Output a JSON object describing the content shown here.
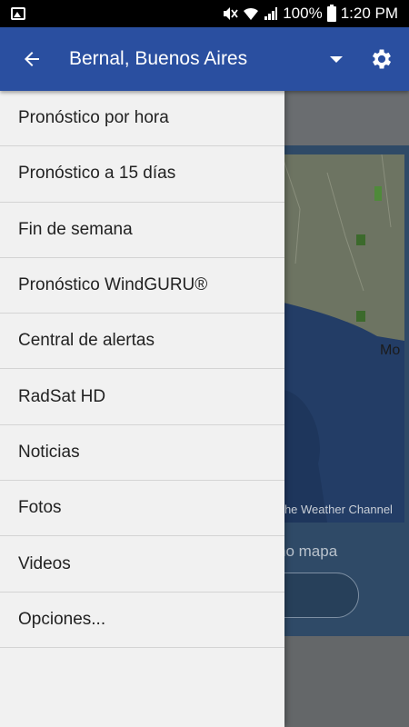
{
  "status_bar": {
    "battery": "100%",
    "time": "1:20 PM"
  },
  "app_bar": {
    "title": "Bernal, Buenos Aires"
  },
  "background": {
    "map_credit": "The Weather Channel",
    "map_label": "no mapa",
    "map_city_fragment": "Mo"
  },
  "drawer": {
    "items": [
      {
        "label": "Pronóstico por hora"
      },
      {
        "label": "Pronóstico a 15 días"
      },
      {
        "label": "Fin de semana"
      },
      {
        "label": "Pronóstico WindGURU®"
      },
      {
        "label": "Central de alertas"
      },
      {
        "label": "RadSat HD"
      },
      {
        "label": "Noticias"
      },
      {
        "label": "Fotos"
      },
      {
        "label": "Videos"
      },
      {
        "label": "Opciones..."
      }
    ]
  },
  "colors": {
    "app_bar": "#2a4fa0",
    "drawer_bg": "#f1f1f1",
    "status_bar": "#000000"
  },
  "icons": [
    "image-icon",
    "mute-icon",
    "wifi-icon",
    "signal-icon",
    "battery-icon",
    "back-arrow-icon",
    "dropdown-icon",
    "gear-icon"
  ]
}
